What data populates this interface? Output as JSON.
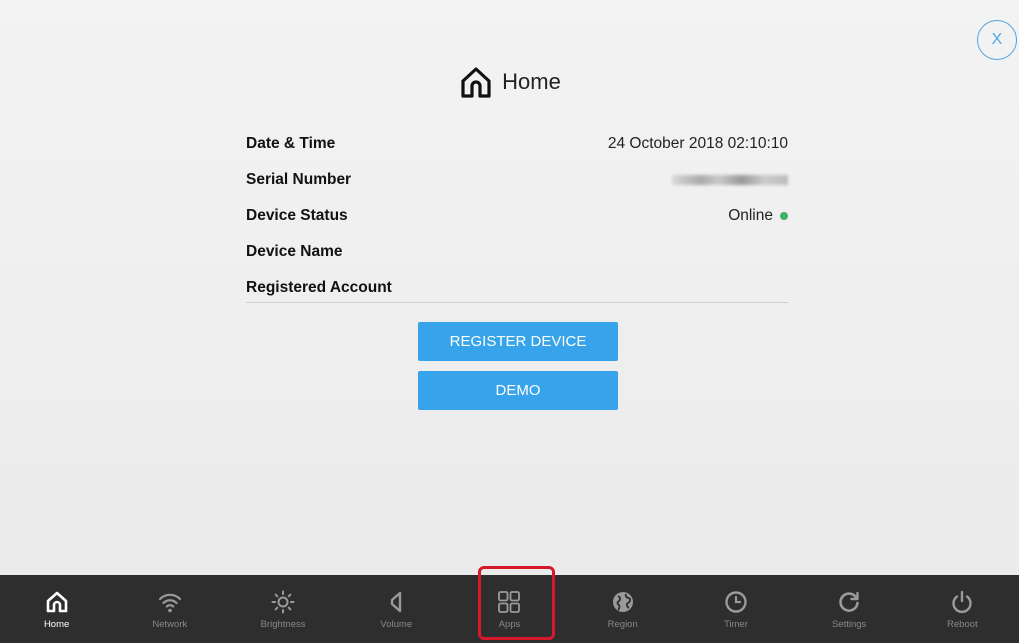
{
  "header": {
    "title": "Home",
    "close_label": "X"
  },
  "info": {
    "rows": [
      {
        "label": "Date & Time",
        "value": "24 October 2018 02:10:10"
      },
      {
        "label": "Serial Number",
        "value": ""
      },
      {
        "label": "Device Status",
        "value": "Online"
      },
      {
        "label": "Device Name",
        "value": ""
      },
      {
        "label": "Registered Account",
        "value": ""
      }
    ]
  },
  "buttons": {
    "register": "REGISTER DEVICE",
    "demo": "DEMO"
  },
  "taskbar": {
    "items": [
      {
        "label": "Home",
        "icon": "home-icon"
      },
      {
        "label": "Network",
        "icon": "wifi-icon"
      },
      {
        "label": "Brightness",
        "icon": "brightness-icon"
      },
      {
        "label": "Volume",
        "icon": "volume-icon"
      },
      {
        "label": "Apps",
        "icon": "apps-icon"
      },
      {
        "label": "Region",
        "icon": "globe-icon"
      },
      {
        "label": "Timer",
        "icon": "clock-icon"
      },
      {
        "label": "Settings",
        "icon": "refresh-icon"
      },
      {
        "label": "Reboot",
        "icon": "power-icon"
      }
    ]
  },
  "colors": {
    "accent": "#37a3ea",
    "online": "#3fb067",
    "highlight": "#d6192a",
    "taskbar": "#2e2e2e"
  }
}
